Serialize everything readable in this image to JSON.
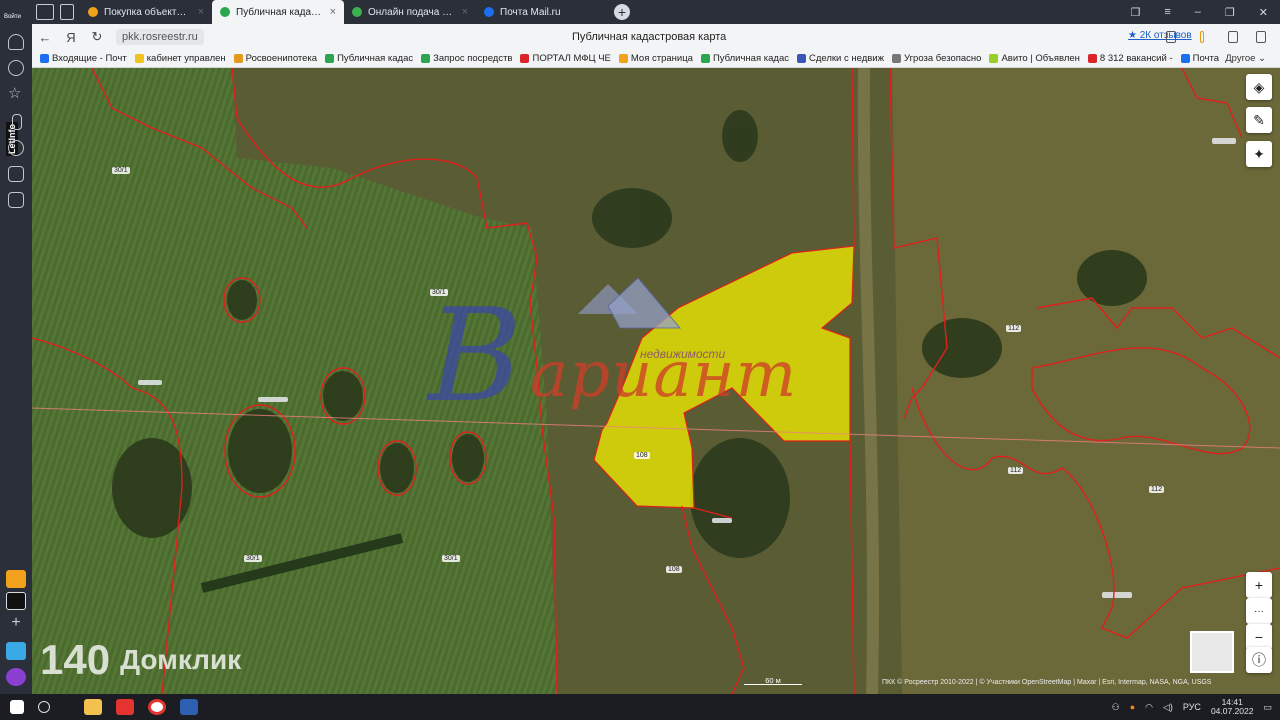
{
  "browser": {
    "login_label": "Войти",
    "tabs": [
      {
        "label": "Покупка объекта недвиж",
        "color": "#f0a21a",
        "active": false
      },
      {
        "label": "Публичная кадастровая",
        "color": "#2aa64e",
        "active": true
      },
      {
        "label": "Онлайн подача заявки н",
        "color": "#3bb24f",
        "active": false
      },
      {
        "label": "Почта Mail.ru",
        "color": "#1b6ff0",
        "active": false
      }
    ],
    "url": "pkk.rosreestr.ru",
    "page_title": "Публичная кадастровая карта",
    "reviews": "★ 2К отзывов",
    "bookmarks": [
      {
        "label": "Входящие - Почт",
        "color": "#1b6ff0"
      },
      {
        "label": "кабинет управлен",
        "color": "#f1c21b"
      },
      {
        "label": "Росвоенипотека",
        "color": "#e39a1c"
      },
      {
        "label": "Публичная кадас",
        "color": "#2aa64e"
      },
      {
        "label": "Запрос посредств",
        "color": "#2aa64e"
      },
      {
        "label": "ПОРТАЛ МФЦ ЧЕ",
        "color": "#d8262a"
      },
      {
        "label": "Моя страница",
        "color": "#f0a21a"
      },
      {
        "label": "Публичная кадас",
        "color": "#2aa64e"
      },
      {
        "label": "Сделки с недвиж",
        "color": "#3a57b7"
      },
      {
        "label": "Угроза безопасно",
        "color": "#777777"
      },
      {
        "label": "Авито | Объявлен",
        "color": "#97cf26"
      },
      {
        "label": "8 312 вакансий - ",
        "color": "#d8262a"
      },
      {
        "label": "Почта",
        "color": "#1b6ff0"
      }
    ],
    "bookmarks_other": "Другое ⌄",
    "sidebar_label": "LetInfo"
  },
  "map": {
    "parcel_labels": [
      {
        "text": "30/1"
      },
      {
        "text": "30/1"
      },
      {
        "text": "30/1"
      },
      {
        "text": "30/1"
      },
      {
        "text": "108"
      },
      {
        "text": "108"
      },
      {
        "text": "112"
      },
      {
        "text": "112"
      },
      {
        "text": "112"
      }
    ],
    "scale_label": "60 м",
    "attribution": "ПКК © Росреестр 2010-2022 | © Участники OpenStreetMap | Maxar | Esri, Intermap, NASA, NGA, USGS",
    "buttons": {
      "layers": "◈",
      "ruler": "✎",
      "locate": "✦",
      "zoom_in": "+",
      "more": "···",
      "zoom_out": "−",
      "info": "ⓘ"
    },
    "highlight_color": "#f4f000",
    "boundary_color": "#e0201d"
  },
  "watermarks": {
    "logo_letter": "В",
    "logo_word": "ариант",
    "logo_sub": "недвижимости",
    "site_number": "140",
    "site_name": "Домклик"
  },
  "taskbar": {
    "lang": "РУС",
    "time": "14:41",
    "date": "04.07.2022"
  }
}
